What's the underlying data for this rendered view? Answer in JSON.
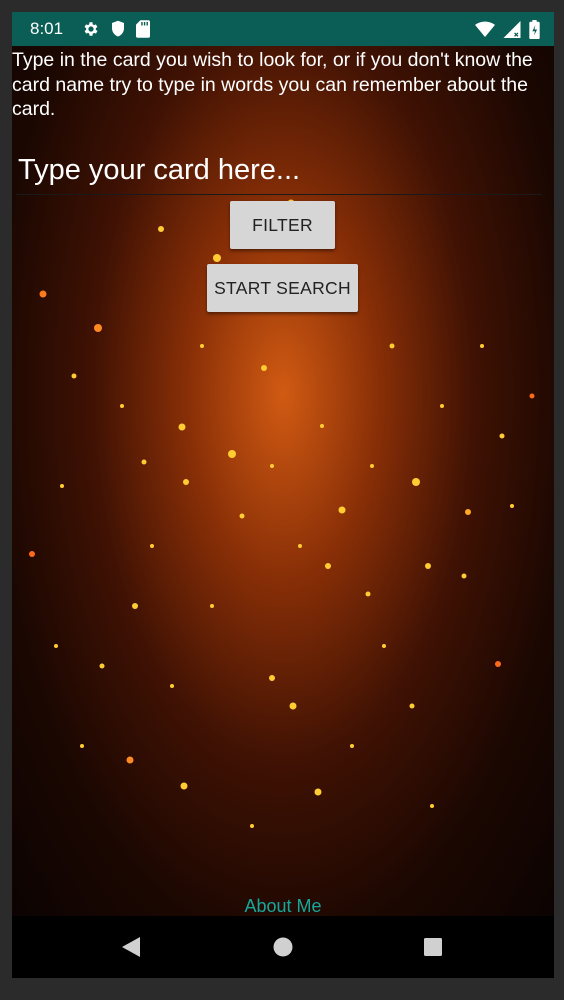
{
  "status_bar": {
    "time": "8:01",
    "left_icons": [
      "gear-icon",
      "shield-icon",
      "sd-card-icon"
    ],
    "right_icons": [
      "wifi-icon",
      "signal-icon",
      "battery-icon"
    ],
    "background": "#0b5e55"
  },
  "main": {
    "instructions": "Type in the card you wish to look for, or if you don't know the card name try to type in words you can remember about the card.",
    "search": {
      "placeholder": "Type your card here...",
      "value": ""
    },
    "filter_label": "FILTER",
    "start_search_label": "START SEARCH",
    "about_label": "About Me"
  },
  "nav_bar": {
    "buttons": [
      "back-icon",
      "home-icon",
      "recents-icon"
    ]
  },
  "colors": {
    "accent": "#17a79a",
    "button_bg": "#d6d6d6",
    "status_bar": "#0b5e55"
  }
}
